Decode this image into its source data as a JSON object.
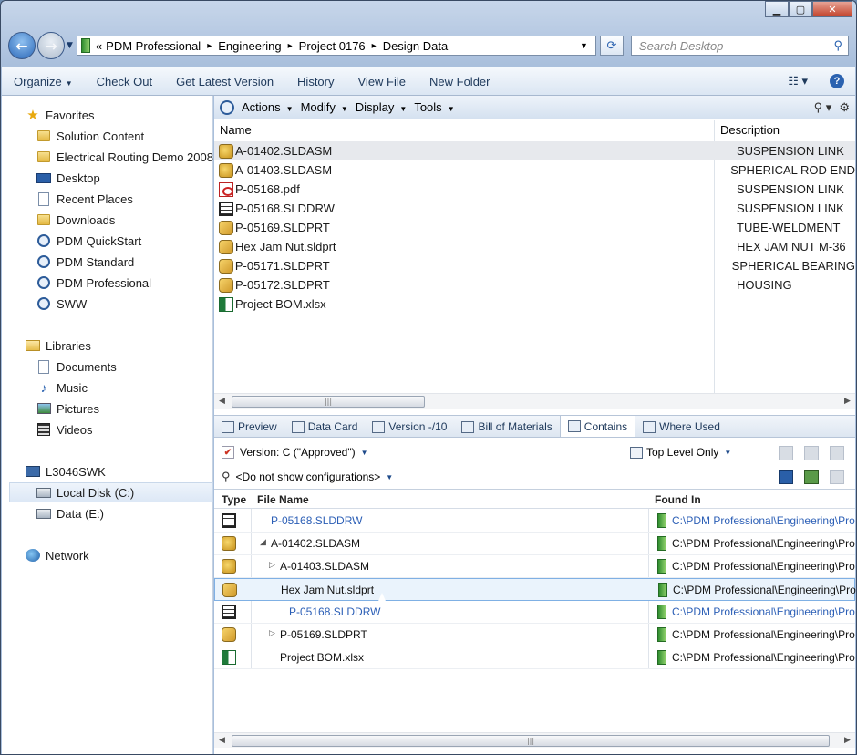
{
  "window": {
    "caption_buttons": [
      "minimize",
      "maximize",
      "close"
    ]
  },
  "address_bar": {
    "crumbs": [
      "PDM Professional",
      "Engineering",
      "Project 0176",
      "Design Data"
    ],
    "overflow": "«",
    "separator": "▸"
  },
  "search": {
    "placeholder": "Search Desktop"
  },
  "toolbar": {
    "items": [
      "Organize",
      "Check Out",
      "Get Latest Version",
      "History",
      "View File",
      "New Folder"
    ]
  },
  "nav": {
    "favorites_header": "Favorites",
    "favorites": [
      "Solution Content",
      "Electrical Routing Demo 2008",
      "Desktop",
      "Recent Places",
      "Downloads",
      "PDM QuickStart",
      "PDM Standard",
      "PDM Professional",
      "SWW"
    ],
    "libraries_header": "Libraries",
    "libraries": [
      "Documents",
      "Music",
      "Pictures",
      "Videos"
    ],
    "computer_header": "L3046SWK",
    "drives": [
      "Local Disk (C:)",
      "Data (E:)"
    ],
    "network": "Network"
  },
  "pdm_menu": [
    "Actions",
    "Modify",
    "Display",
    "Tools"
  ],
  "file_list": {
    "columns": [
      "Name",
      "Description"
    ],
    "rows": [
      {
        "name": "A-01402.SLDASM",
        "desc": "SUSPENSION LINK",
        "icon": "assembly-icon"
      },
      {
        "name": "A-01403.SLDASM",
        "desc": "SPHERICAL ROD END",
        "icon": "assembly-icon"
      },
      {
        "name": "P-05168.pdf",
        "desc": "SUSPENSION LINK",
        "icon": "pdf-icon"
      },
      {
        "name": "P-05168.SLDDRW",
        "desc": "SUSPENSION LINK",
        "icon": "drawing-icon"
      },
      {
        "name": "P-05169.SLDPRT",
        "desc": "TUBE-WELDMENT",
        "icon": "part-icon"
      },
      {
        "name": "Hex Jam Nut.sldprt",
        "desc": "HEX JAM NUT M-36",
        "icon": "part-icon"
      },
      {
        "name": "P-05171.SLDPRT",
        "desc": "SPHERICAL BEARING",
        "icon": "part-icon"
      },
      {
        "name": "P-05172.SLDPRT",
        "desc": "HOUSING",
        "icon": "part-icon"
      },
      {
        "name": "Project BOM.xlsx",
        "desc": "",
        "icon": "excel-icon"
      }
    ]
  },
  "tabs": [
    "Preview",
    "Data Card",
    "Version -/10",
    "Bill of Materials",
    "Contains",
    "Where Used"
  ],
  "active_tab": "Contains",
  "contains_options": {
    "version": "Version: C (\"Approved\")",
    "configurations": "<Do not show configurations>",
    "level": "Top Level Only"
  },
  "contains_table": {
    "columns": [
      "Type",
      "File Name",
      "Found In"
    ],
    "rows": [
      {
        "name": "P-05168.SLDDRW",
        "path": "C:\\PDM Professional\\Engineering\\Pro",
        "ref": true,
        "icon": "drawing-icon"
      },
      {
        "name": "A-01402.SLDASM",
        "path": "C:\\PDM Professional\\Engineering\\Pro",
        "ref": false,
        "icon": "assembly-icon"
      },
      {
        "name": "A-01403.SLDASM",
        "path": "C:\\PDM Professional\\Engineering\\Pro",
        "ref": false,
        "icon": "assembly-icon"
      },
      {
        "name": "Hex Jam Nut.sldprt",
        "path": "C:\\PDM Professional\\Engineering\\Pro",
        "ref": false,
        "icon": "part-icon"
      },
      {
        "name": "P-05168.SLDDRW",
        "path": "C:\\PDM Professional\\Engineering\\Pro",
        "ref": true,
        "icon": "drawing-icon"
      },
      {
        "name": "P-05169.SLDPRT",
        "path": "C:\\PDM Professional\\Engineering\\Pro",
        "ref": false,
        "icon": "part-icon"
      },
      {
        "name": "Project BOM.xlsx",
        "path": "C:\\PDM Professional\\Engineering\\Pro",
        "ref": false,
        "icon": "excel-icon"
      }
    ]
  }
}
